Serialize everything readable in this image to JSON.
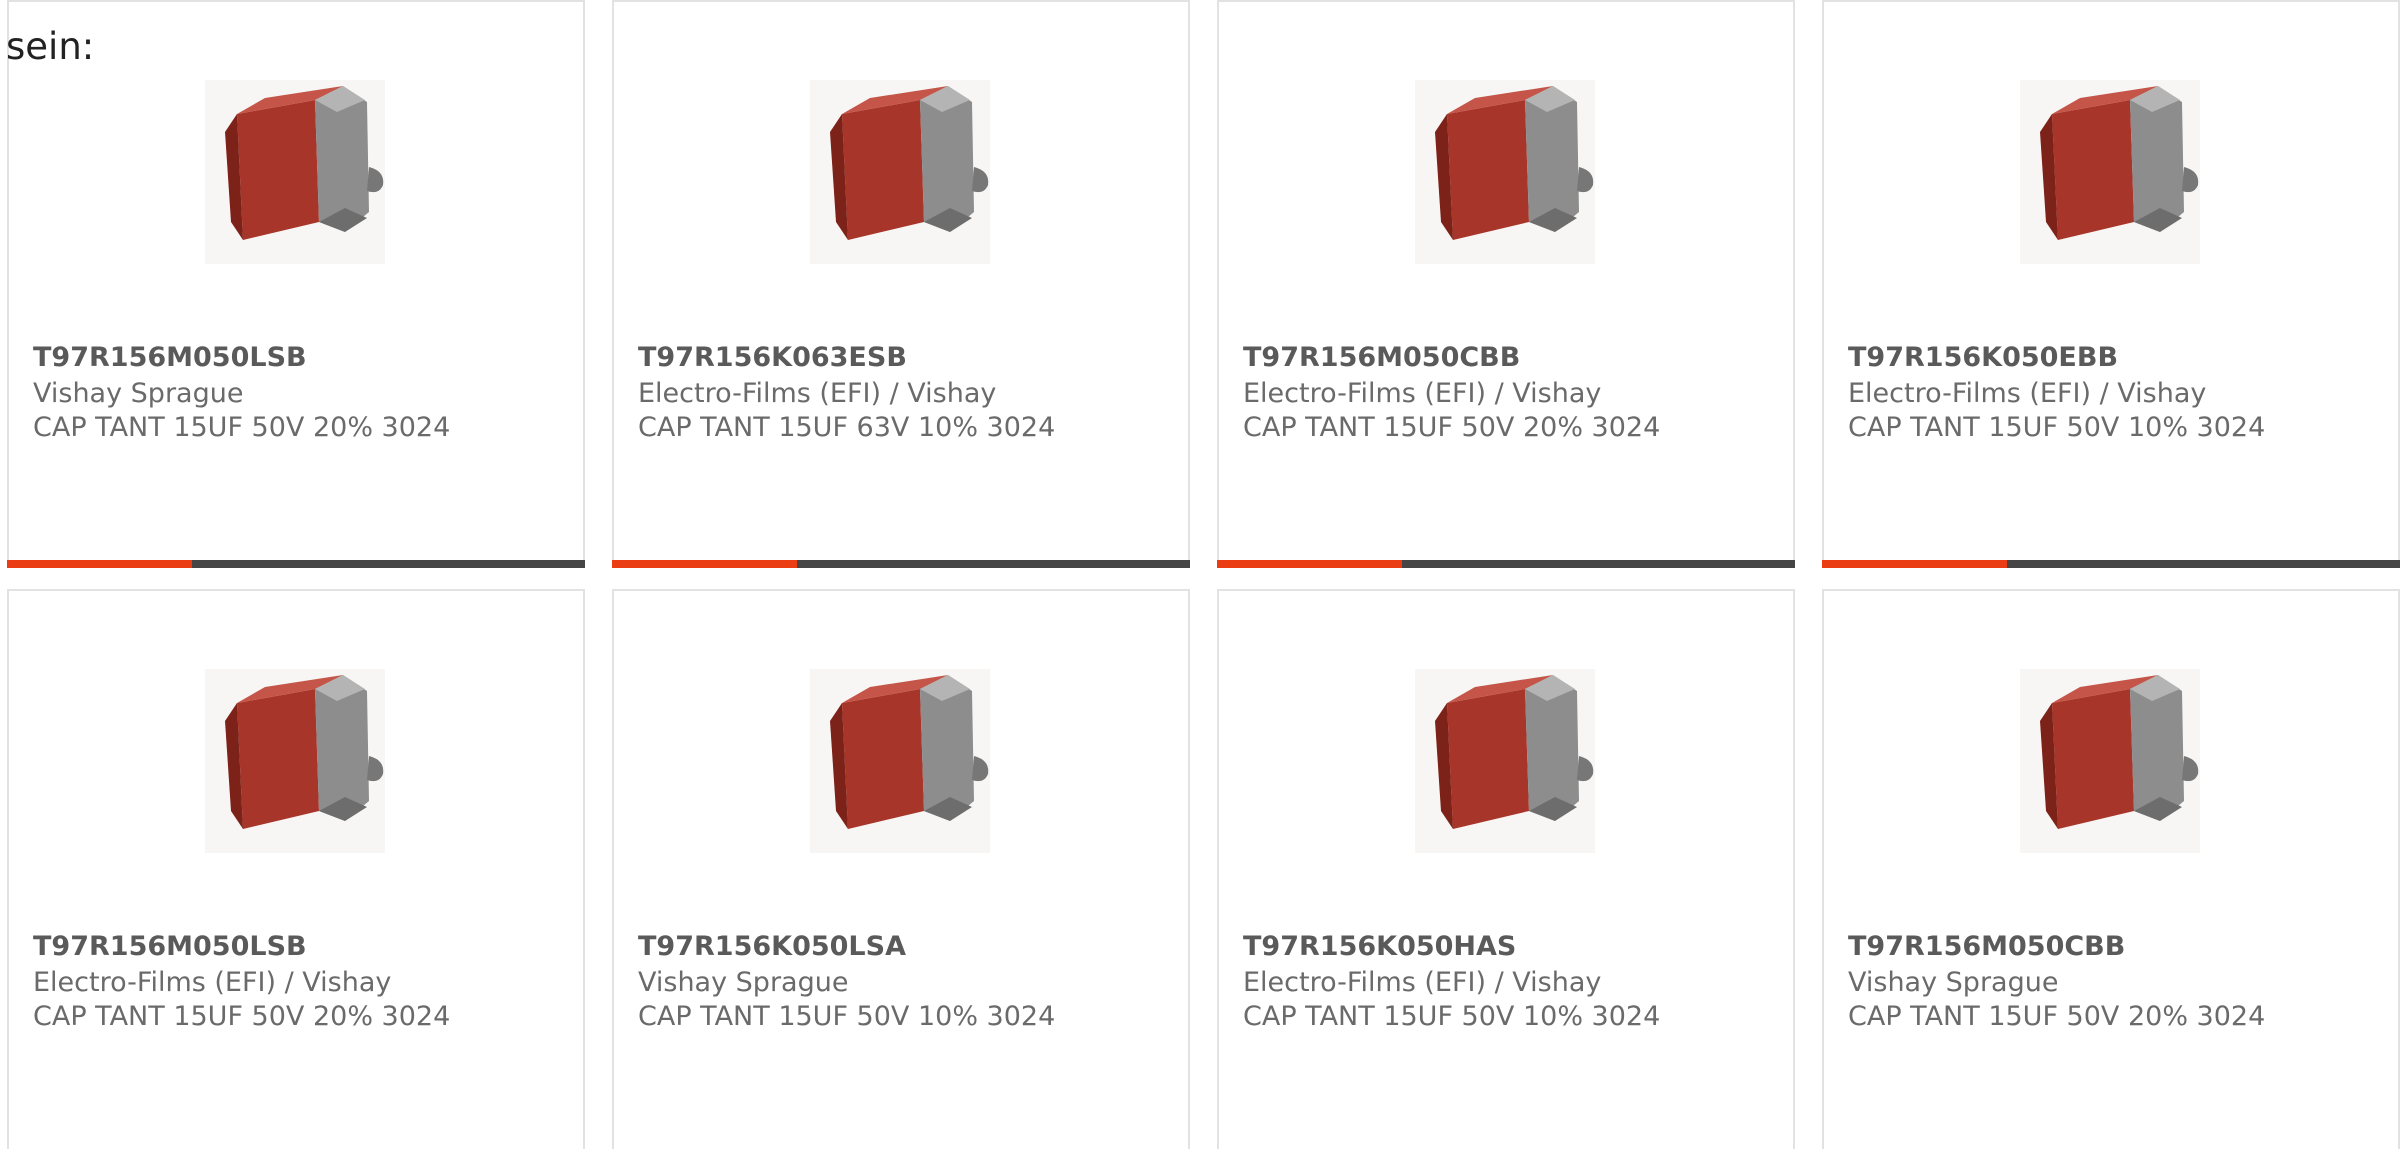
{
  "intro_text": "sein:",
  "colors": {
    "accent": "#ea3d13",
    "bar_track": "#454545",
    "border": "#e2e2e2",
    "capacitor_body": "#a8352a",
    "capacitor_terminal": "#8d8d8d"
  },
  "image_icon": "tantalum-capacitor-image",
  "products": [
    {
      "part_number": "T97R156M050LSB",
      "manufacturer": "Vishay Sprague",
      "description": "CAP TANT 15UF 50V 20% 3024",
      "progress": 0.32
    },
    {
      "part_number": "T97R156K063ESB",
      "manufacturer": "Electro-Films (EFI) / Vishay",
      "description": "CAP TANT 15UF 63V 10% 3024",
      "progress": 0.32
    },
    {
      "part_number": "T97R156M050CBB",
      "manufacturer": "Electro-Films (EFI) / Vishay",
      "description": "CAP TANT 15UF 50V 20% 3024",
      "progress": 0.32
    },
    {
      "part_number": "T97R156K050EBB",
      "manufacturer": "Electro-Films (EFI) / Vishay",
      "description": "CAP TANT 15UF 50V 10% 3024",
      "progress": 0.32
    },
    {
      "part_number": "T97R156M050LSB",
      "manufacturer": "Electro-Films (EFI) / Vishay",
      "description": "CAP TANT 15UF 50V 20% 3024",
      "progress": null
    },
    {
      "part_number": "T97R156K050LSA",
      "manufacturer": "Vishay Sprague",
      "description": "CAP TANT 15UF 50V 10% 3024",
      "progress": null
    },
    {
      "part_number": "T97R156K050HAS",
      "manufacturer": "Electro-Films (EFI) / Vishay",
      "description": "CAP TANT 15UF 50V 10% 3024",
      "progress": null
    },
    {
      "part_number": "T97R156M050CBB",
      "manufacturer": "Vishay Sprague",
      "description": "CAP TANT 15UF 50V 20% 3024",
      "progress": null
    }
  ]
}
